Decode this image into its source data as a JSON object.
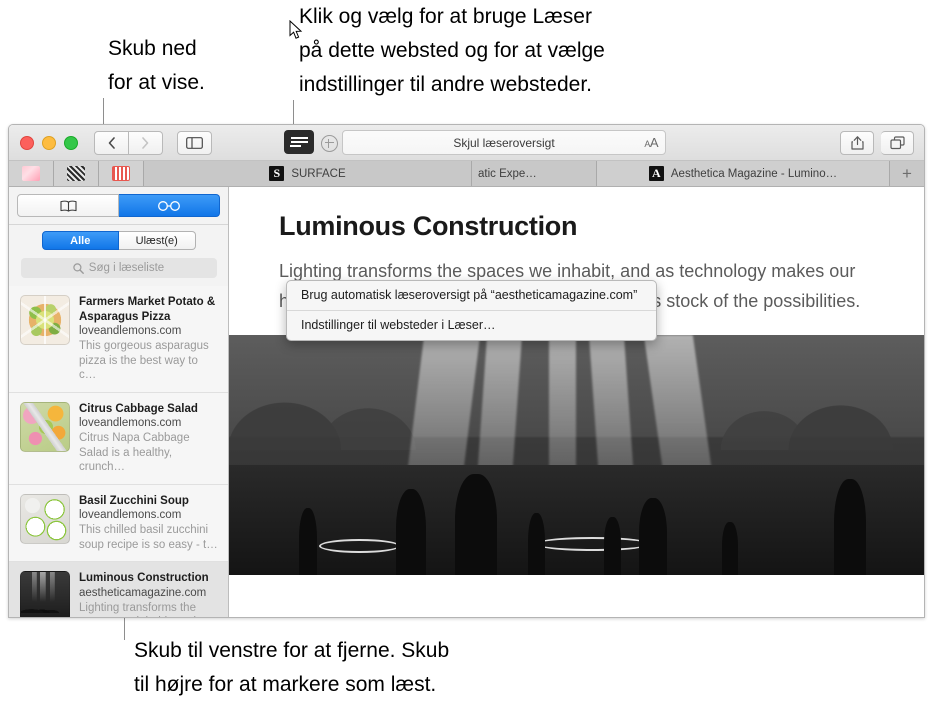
{
  "callouts": {
    "top_left": "Skub ned\nfor at vise.",
    "top_right": "Klik og vælg for at bruge Læser\npå dette websted og for at vælge\nindstillinger til andre websteder.",
    "bottom": "Skub til venstre for at fjerne. Skub\ntil højre for at markere som læst."
  },
  "toolbar": {
    "back_label": "‹",
    "forward_label": "›",
    "sidebar_icon": "sidebar-icon",
    "reader_icon": "reader-icon",
    "add_bookmark_icon": "plus-circle-icon",
    "url_text": "Skjul læseroversigt",
    "text_size_label": "A",
    "text_size_small_label": "A",
    "share_icon": "share-icon",
    "tab_overview_icon": "tab-overview-icon"
  },
  "menu": {
    "items": [
      {
        "label": "Brug automatisk læseroversigt på “aestheticamagazine.com”"
      },
      {
        "label": "Indstillinger til websteder i Læser…"
      }
    ]
  },
  "tabs": {
    "pinned": [
      {
        "name": "pinned-tab-1"
      },
      {
        "name": "pinned-tab-2"
      },
      {
        "name": "pinned-tab-3"
      }
    ],
    "items": [
      {
        "label": "SURFACE",
        "favicon": "S",
        "active": false
      },
      {
        "label": "atic Expe…",
        "favicon": "",
        "active": false
      },
      {
        "label": "Aesthetica Magazine - Lumino…",
        "favicon": "A",
        "active": true
      }
    ],
    "new_tab_label": "+"
  },
  "sidebar": {
    "bookmarks_icon": "book-icon",
    "readinglist_icon": "glasses-icon",
    "filters": [
      {
        "label": "Alle",
        "active": true
      },
      {
        "label": "Ulæst(e)",
        "active": false
      }
    ],
    "search_placeholder": "Søg i læseliste",
    "search_icon": "search-icon",
    "items": [
      {
        "title": "Farmers Market Potato & Asparagus Pizza",
        "url": "loveandlemons.com",
        "snippet": "This gorgeous asparagus pizza is the best way to c…",
        "thumb": "pizza",
        "selected": false
      },
      {
        "title": "Citrus Cabbage Salad",
        "url": "loveandlemons.com",
        "snippet": "Citrus Napa Cabbage Salad is a healthy, crunch…",
        "thumb": "salad",
        "selected": false
      },
      {
        "title": "Basil Zucchini Soup",
        "url": "loveandlemons.com",
        "snippet": "This chilled basil zucchini soup recipe is so easy - t…",
        "thumb": "soup",
        "selected": false
      },
      {
        "title": "Luminous Construction",
        "url": "aestheticamagazine.com",
        "snippet": "Lighting transforms the spaces we inhabit, and as…",
        "thumb": "luminous",
        "selected": true
      }
    ]
  },
  "article": {
    "title": "Luminous Construction",
    "lede": "Lighting transforms the spaces we inhabit, and as technology makes our homes ever more responsive, a new book takes stock of the possibilities.",
    "hero_alt": "light-installation-photo"
  },
  "colors": {
    "accent_blue": "#1176e8",
    "toolbar_gray": "#e4e4e4",
    "tabbar_gray": "#c8c8c8",
    "sidebar_gray": "#f3f3f3",
    "callout_line": "#8e8e8e"
  }
}
